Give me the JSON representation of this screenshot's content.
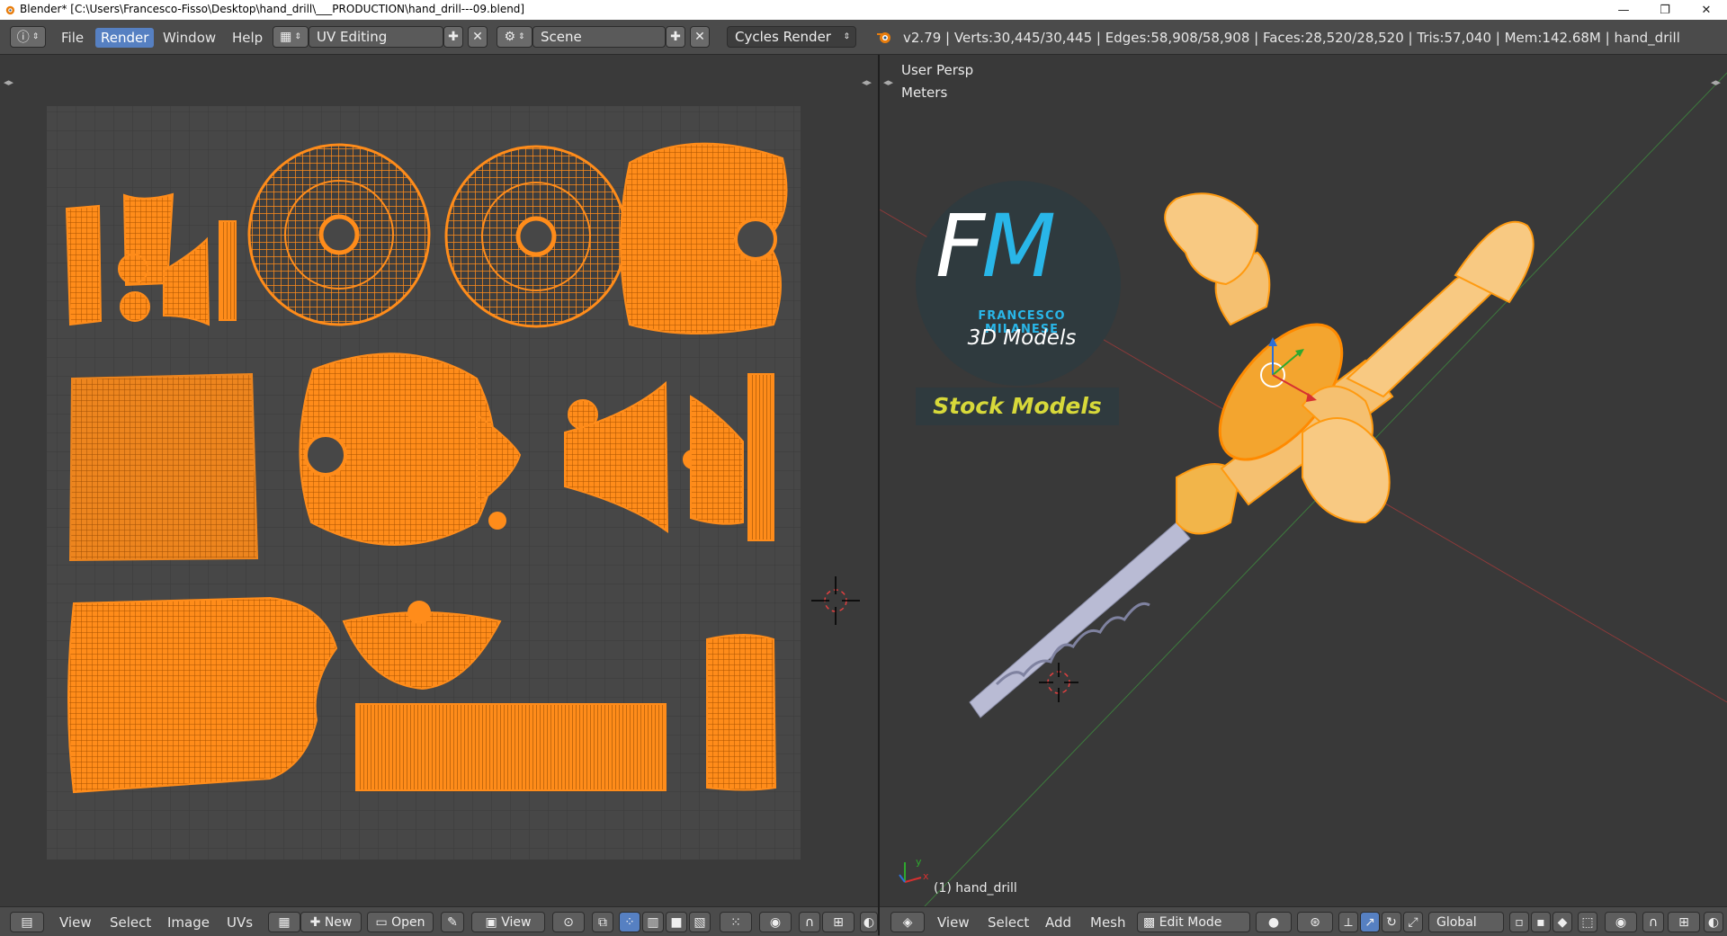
{
  "window": {
    "title": "Blender* [C:\\Users\\Francesco-Fisso\\Desktop\\hand_drill\\___PRODUCTION\\hand_drill---09.blend]",
    "minimize": "—",
    "restore": "❐",
    "close": "✕"
  },
  "info_header": {
    "menus": [
      "File",
      "Render",
      "Window",
      "Help"
    ],
    "active_menu": "Render",
    "layout": "UV Editing",
    "scene": "Scene",
    "engine": "Cycles Render",
    "stats": "v2.79 | Verts:30,445/30,445 | Edges:58,908/58,908 | Faces:28,520/28,520 | Tris:57,040 | Mem:142.68M | hand_drill"
  },
  "uv_editor": {
    "menus": [
      "View",
      "Select",
      "Image",
      "UVs"
    ],
    "new_label": "New",
    "open_label": "Open",
    "view_label": "View"
  },
  "viewport": {
    "view_name": "User Persp",
    "units": "Meters",
    "object_label": "(1) hand_drill",
    "menus": [
      "View",
      "Select",
      "Add",
      "Mesh"
    ],
    "mode": "Edit Mode",
    "orientation": "Global",
    "axis_x": "x",
    "axis_y": "y"
  },
  "watermark": {
    "logo_letters": "FM",
    "brand": "FRANCESCO MILANESE",
    "subtitle": "3D Models",
    "badge": "Stock Models"
  },
  "colors": {
    "uv_orange": "#ff8c1a",
    "uv_edge": "#b35a00",
    "selected_menu": "#5680c2",
    "logo_blue": "#29b6e8",
    "badge_yellow": "#d7d93a"
  }
}
